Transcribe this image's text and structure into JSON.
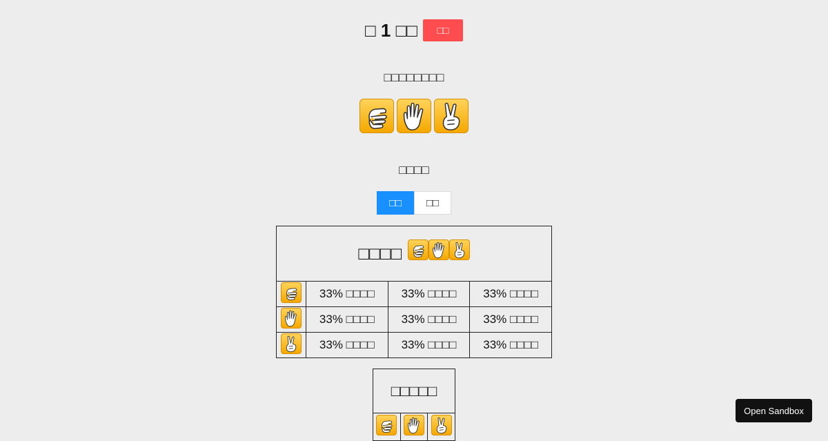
{
  "header": {
    "round_title": "□ 1 □□",
    "reset_label": "□□"
  },
  "choose": {
    "prompt": "□□□□□□□□"
  },
  "mode": {
    "label": "□□□□",
    "options": [
      "□□",
      "□□"
    ],
    "selected_index": 0
  },
  "probability_table": {
    "title": "□□□□",
    "header_icons": [
      "rock-icon",
      "paper-icon",
      "scissors-icon"
    ],
    "rows": [
      {
        "icon": "rock-icon",
        "cells": [
          "33% □□□□",
          "33% □□□□",
          "33% □□□□"
        ]
      },
      {
        "icon": "paper-icon",
        "cells": [
          "33% □□□□",
          "33% □□□□",
          "33% □□□□"
        ]
      },
      {
        "icon": "scissors-icon",
        "cells": [
          "33% □□□□",
          "33% □□□□",
          "33% □□□□"
        ]
      }
    ]
  },
  "result_table": {
    "title": "□□□□□",
    "icons": [
      "rock-icon",
      "paper-icon",
      "scissors-icon"
    ]
  },
  "sandbox": {
    "label": "Open Sandbox"
  },
  "colors": {
    "background": "#ededed",
    "reset": "#ff4d4f",
    "active_toggle": "#1890ff",
    "hand_tile": "#f5b800"
  }
}
